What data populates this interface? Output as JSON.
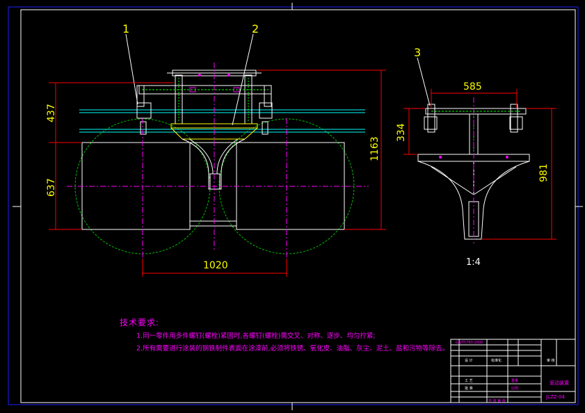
{
  "callouts": [
    "1",
    "2",
    "3"
  ],
  "dimensions": {
    "front_height_top": "437",
    "front_height_bottom": "637",
    "front_total_height": "1163",
    "front_width": "1020",
    "side_width": "585",
    "side_height_top": "334",
    "side_total_height": "981"
  },
  "scale": "1:4",
  "requirements": {
    "title": "技术要求:",
    "items": [
      "1.同一零件用多件螺钉(螺栓)紧固时,各螺钉(螺栓)需交叉、对称、逐步、均匀拧紧;",
      "2.所有需要进行涂装的钢铁制件表面在涂漆前,必须将铁锈、氧化皮、油脂、灰尘、泥土、盐和污物等除去。"
    ]
  },
  "title_block": {
    "standard": "GB/T5780-2000",
    "drawing_title": "驱动装置",
    "drawing_number": "JLZZ-04",
    "cell_a": "设 计",
    "cell_b": "标准化",
    "cell_c": "审 核",
    "cell_d": "工 艺",
    "cell_e": "批 准",
    "cell_f": "比例",
    "cell_g": "共 张 第 张",
    "cell_h": "重量"
  },
  "colors": {
    "background": "#000000",
    "outline": "#ffffff",
    "dimension": "#ff0000",
    "dimension_text": "#ffff00",
    "centerline": "#ff00ff",
    "hidden": "#00ff00",
    "border": "#0000ff",
    "cyan_lines": "#00ffff"
  }
}
